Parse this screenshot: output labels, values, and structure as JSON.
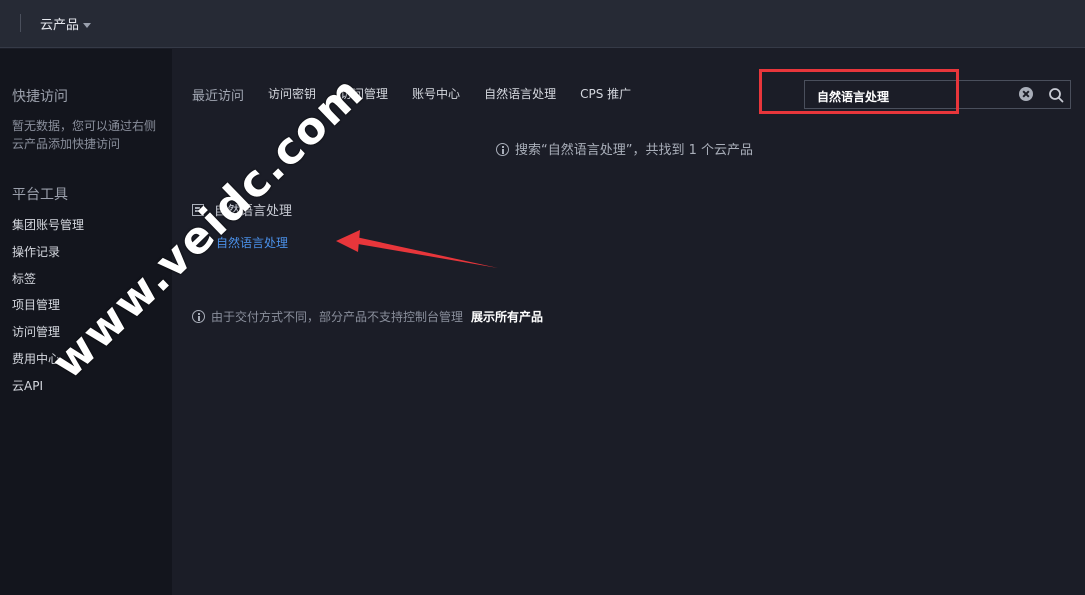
{
  "topbar": {
    "product_menu": "云产品"
  },
  "sidebar": {
    "quick_access_title": "快捷访问",
    "quick_access_empty": "暂无数据，您可以通过右侧云产品添加快捷访问",
    "platform_tools_title": "平台工具",
    "tools": [
      "集团账号管理",
      "操作记录",
      "标签",
      "项目管理",
      "访问管理",
      "费用中心",
      "云API"
    ]
  },
  "tabs": [
    "最近访问",
    "访问密钥",
    "访问管理",
    "账号中心",
    "自然语言处理",
    "CPS 推广"
  ],
  "search": {
    "value": "自然语言处理"
  },
  "result_tip": "搜索“自然语言处理”，共找到 1 个云产品",
  "category": {
    "title": "自然语言处理",
    "results": [
      "自然语言处理"
    ]
  },
  "footer": {
    "note": "由于交付方式不同，部分产品不支持控制台管理",
    "show_all": "展示所有产品"
  },
  "watermark": "www.veidc.com",
  "colors": {
    "highlight": "#e8363b",
    "link": "#4a8fe7",
    "background": "#1b1d27",
    "sidebar": "#13151d"
  }
}
